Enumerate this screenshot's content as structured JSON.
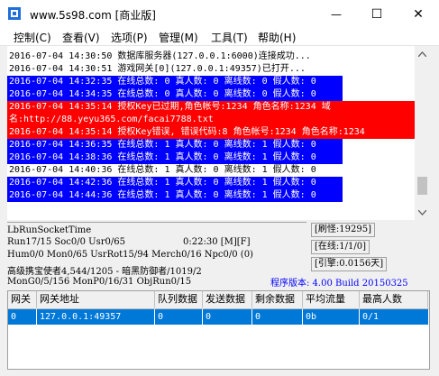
{
  "window": {
    "title": "www.5s98.com [商业版]",
    "controls": {
      "minimize_glyph": "—",
      "maximize_glyph": "☐",
      "close_glyph": "✕"
    }
  },
  "menu": [
    "控制(C)",
    "查看(V)",
    "选项(P)",
    "管理(M)",
    "工具(T)",
    "帮助(H)"
  ],
  "log": [
    {
      "text": "2016-07-04 14:30:50 数据库服务器(127.0.0.1:6000)连接成功...",
      "style": "plain"
    },
    {
      "text": "2016-07-04 14:30:51 游戏网关[0](127.0.0.1:49357)已打开...",
      "style": "plain"
    },
    {
      "text": "2016-07-04 14:32:35 在线总数: 0 真人数: 0 离线数: 0 假人数: 0",
      "style": "blue"
    },
    {
      "text": "2016-07-04 14:34:35 在线总数: 0 真人数: 0 离线数: 0 假人数: 0",
      "style": "blue"
    },
    {
      "text": "2016-07-04 14:35:14 授权Key已过期,角色帐号:1234 角色名称:1234 域",
      "style": "red"
    },
    {
      "text": "名:http://88.yeyu365.com/facai7788.txt",
      "style": "red"
    },
    {
      "text": "2016-07-04 14:35:14 授权Key错误, 错误代码:8 角色帐号:1234 角色名称:1234",
      "style": "red"
    },
    {
      "text": "2016-07-04 14:36:35 在线总数: 1 真人数: 0 离线数: 1 假人数: 0",
      "style": "blue"
    },
    {
      "text": "2016-07-04 14:38:36 在线总数: 1 真人数: 0 离线数: 1 假人数: 0",
      "style": "blue"
    },
    {
      "text": "2016-07-04 14:40:36 在线总数: 1 真人数: 0 离线数: 1 假人数: 0",
      "style": "plain"
    },
    {
      "text": "2016-07-04 14:42:36 在线总数: 1 真人数: 0 离线数: 1 假人数: 0",
      "style": "blue"
    },
    {
      "text": "2016-07-04 14:44:36 在线总数: 1 真人数: 0 离线数: 1 假人数: 0",
      "style": "blue"
    }
  ],
  "status": {
    "line1": "LbRunSocketTime",
    "line2_left": "Run17/15 Soc0/0 Usr0/65",
    "line2_time": "0:22:30 [M][F]",
    "line3": "Hum0/0 Mon0/65 UsrRot15/94 Merch0/16 Npc0/0 (0)",
    "line4": "高级携宝使者4,544/1205 - 暗黑防御者/1019/2",
    "line5": "MonG0/5/156 MonP0/16/31 ObjRun0/15",
    "refresh": "[刷怪:19295]",
    "online": "[在线:1/1/0]",
    "ingot": "[引擎:0.0156天]",
    "version": "程序版本: 4.00 Build 20150325"
  },
  "table": {
    "headers": [
      "网关",
      "网关地址",
      "队列数据",
      "发送数据",
      "剩余数据",
      "平均流量",
      "最高人数"
    ],
    "rows": [
      [
        "0",
        "127.0.0.1:49357",
        "0",
        "0",
        "0",
        "0b",
        "0/1"
      ]
    ]
  },
  "colors": {
    "log_blue": "#0000ff",
    "log_red": "#ff0000",
    "selection": "#0078d7",
    "version_text": "#0000ff"
  }
}
